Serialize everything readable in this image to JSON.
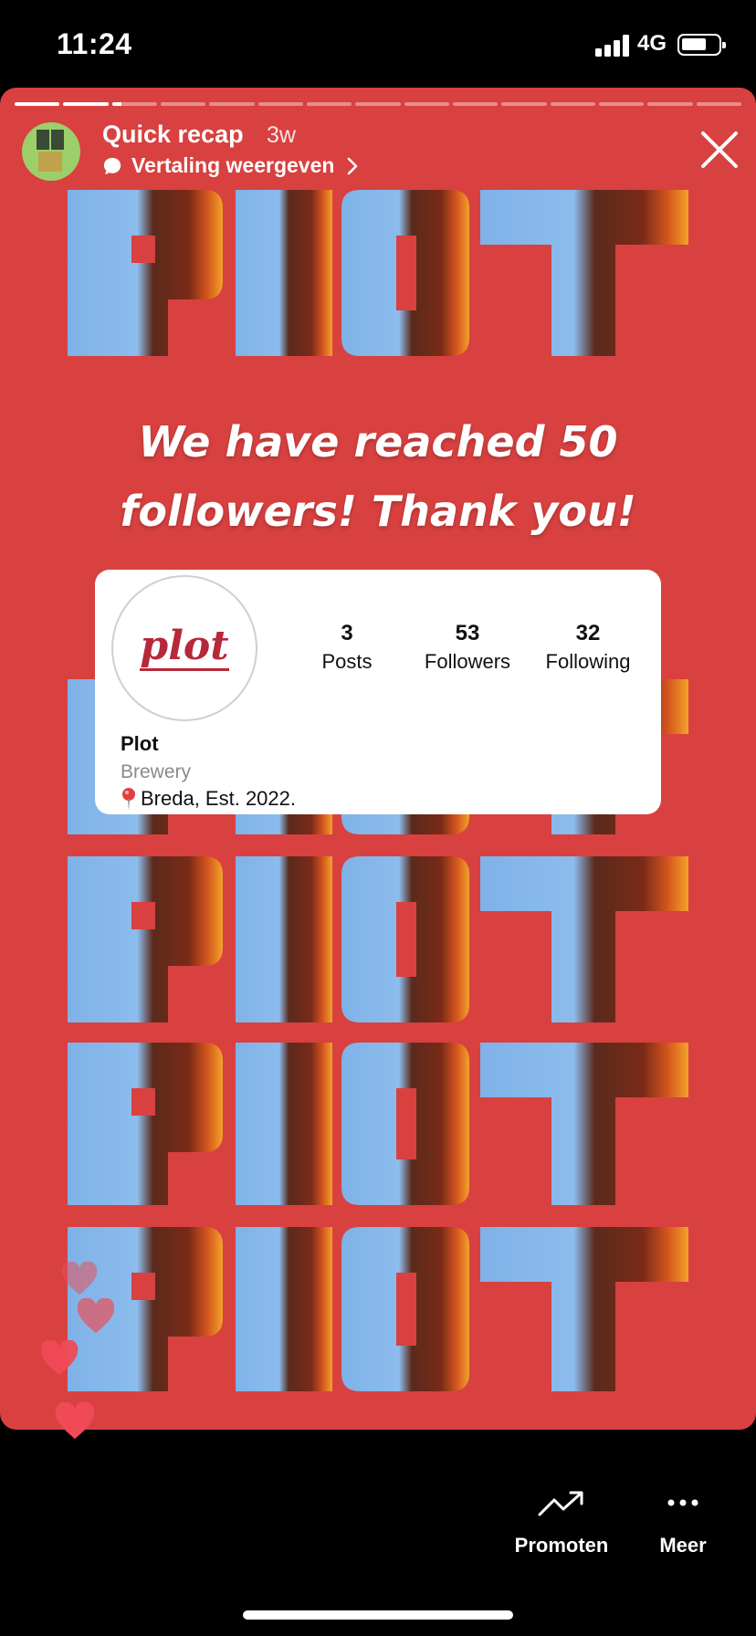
{
  "status_bar": {
    "time": "11:24",
    "network": "4G"
  },
  "story": {
    "progress": {
      "segments": 15,
      "filled": 2,
      "current_fraction": 0.2
    },
    "title": "Quick recap",
    "age": "3w",
    "translate_label": "Vertaling weergeven",
    "big_word": "PLOT",
    "headline_line1": "We have reached 50",
    "headline_line2": "followers! Thank you!",
    "profile": {
      "logo_text": "plot",
      "posts_count": "3",
      "posts_label": "Posts",
      "followers_count": "53",
      "followers_label": "Followers",
      "following_count": "32",
      "following_label": "Following",
      "name": "Plot",
      "category": "Brewery",
      "location": "Breda, Est. 2022."
    }
  },
  "bottom_bar": {
    "promote_label": "Promoten",
    "more_label": "Meer"
  },
  "colors": {
    "story_bg": "#d84140",
    "sky": "#7fb2e8",
    "accent_red": "#b6283a",
    "heart": "#e8505a"
  },
  "icons": [
    "close-icon",
    "speech-bubble-icon",
    "chevron-right-icon",
    "trending-up-icon",
    "ellipsis-icon",
    "location-pin-icon",
    "heart-icon"
  ]
}
